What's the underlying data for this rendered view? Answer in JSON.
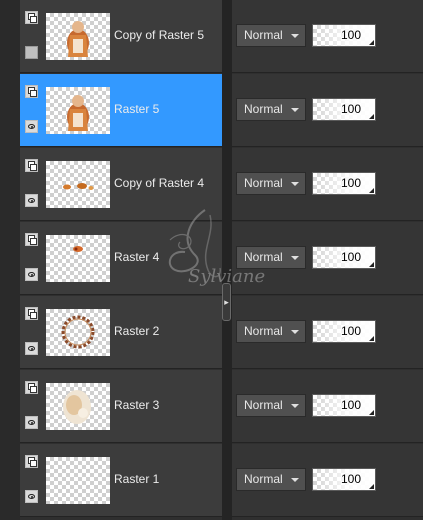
{
  "layers": [
    {
      "name": "Copy of Raster 5",
      "blend_mode": "Normal",
      "opacity": 100,
      "selected": false,
      "visible": false,
      "thumbnail": "figure"
    },
    {
      "name": "Raster 5",
      "blend_mode": "Normal",
      "opacity": 100,
      "selected": true,
      "visible": true,
      "thumbnail": "figure"
    },
    {
      "name": "Copy of Raster 4",
      "blend_mode": "Normal",
      "opacity": 100,
      "selected": false,
      "visible": true,
      "thumbnail": "sparkles"
    },
    {
      "name": "Raster 4",
      "blend_mode": "Normal",
      "opacity": 100,
      "selected": false,
      "visible": true,
      "thumbnail": "ornament"
    },
    {
      "name": "Raster 2",
      "blend_mode": "Normal",
      "opacity": 100,
      "selected": false,
      "visible": true,
      "thumbnail": "wreath"
    },
    {
      "name": "Raster 3",
      "blend_mode": "Normal",
      "opacity": 100,
      "selected": false,
      "visible": true,
      "thumbnail": "lace"
    },
    {
      "name": "Raster 1",
      "blend_mode": "Normal",
      "opacity": 100,
      "selected": false,
      "visible": true,
      "thumbnail": "empty"
    }
  ],
  "colors": {
    "selection": "#3399ff",
    "panel": "#3c3c3c",
    "background": "#2f2f2f"
  },
  "icons": {
    "group": "layer-group-icon",
    "visible": "eye-icon",
    "hidden": "visibility-off-icon",
    "blend_dropdown": "chevron-down-icon",
    "splitter": "chevron-right-icon"
  },
  "watermark": {
    "text": "Sylviane"
  }
}
